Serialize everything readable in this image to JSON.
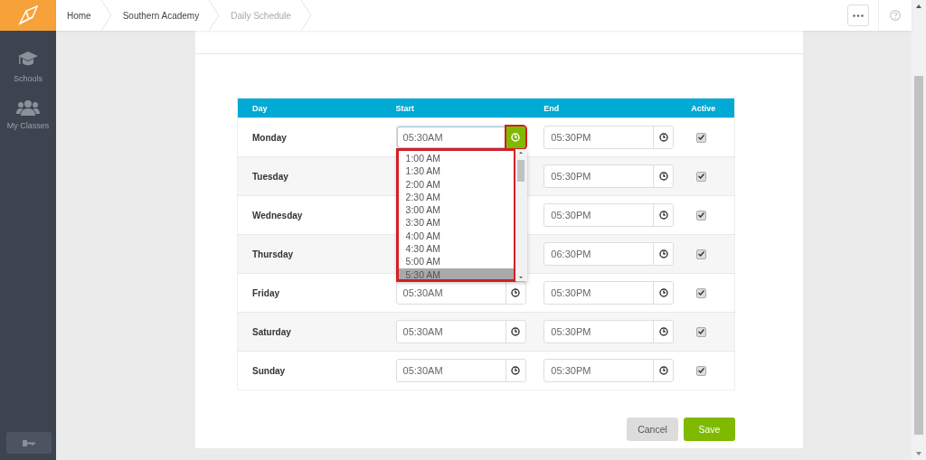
{
  "sidebar": {
    "items": [
      {
        "label": "Schools"
      },
      {
        "label": "My Classes"
      }
    ]
  },
  "breadcrumbs": [
    {
      "label": "Home",
      "current": false
    },
    {
      "label": "Southern Academy",
      "current": false
    },
    {
      "label": "Daily Schedule",
      "current": true
    }
  ],
  "table": {
    "columns": [
      "Day",
      "Start",
      "End",
      "Active"
    ],
    "rows": [
      {
        "day": "Monday",
        "start": "05:30AM",
        "end": "05:30PM",
        "active": true,
        "start_open": true
      },
      {
        "day": "Tuesday",
        "end": "05:30PM",
        "active": true,
        "start_open": false
      },
      {
        "day": "Wednesday",
        "end": "05:30PM",
        "active": true,
        "start_open": false
      },
      {
        "day": "Thursday",
        "end": "06:30PM",
        "active": true,
        "start_open": false
      },
      {
        "day": "Friday",
        "start": "05:30AM",
        "end": "05:30PM",
        "active": true,
        "start_open": false
      },
      {
        "day": "Saturday",
        "start": "05:30AM",
        "end": "05:30PM",
        "active": true,
        "start_open": false
      },
      {
        "day": "Sunday",
        "start": "05:30AM",
        "end": "05:30PM",
        "active": true,
        "start_open": false
      }
    ]
  },
  "time_dropdown": {
    "annotated": true,
    "options": [
      {
        "label": "1:00 AM",
        "selected": false
      },
      {
        "label": "1:30 AM",
        "selected": false
      },
      {
        "label": "2:00 AM",
        "selected": false
      },
      {
        "label": "2:30 AM",
        "selected": false
      },
      {
        "label": "3:00 AM",
        "selected": false
      },
      {
        "label": "3:30 AM",
        "selected": false
      },
      {
        "label": "4:00 AM",
        "selected": false
      },
      {
        "label": "4:30 AM",
        "selected": false
      },
      {
        "label": "5:00 AM",
        "selected": false
      },
      {
        "label": "5:30 AM",
        "selected": true
      }
    ]
  },
  "buttons": [
    {
      "label": "Cancel",
      "kind": "secondary"
    },
    {
      "label": "Save",
      "kind": "primary"
    }
  ]
}
